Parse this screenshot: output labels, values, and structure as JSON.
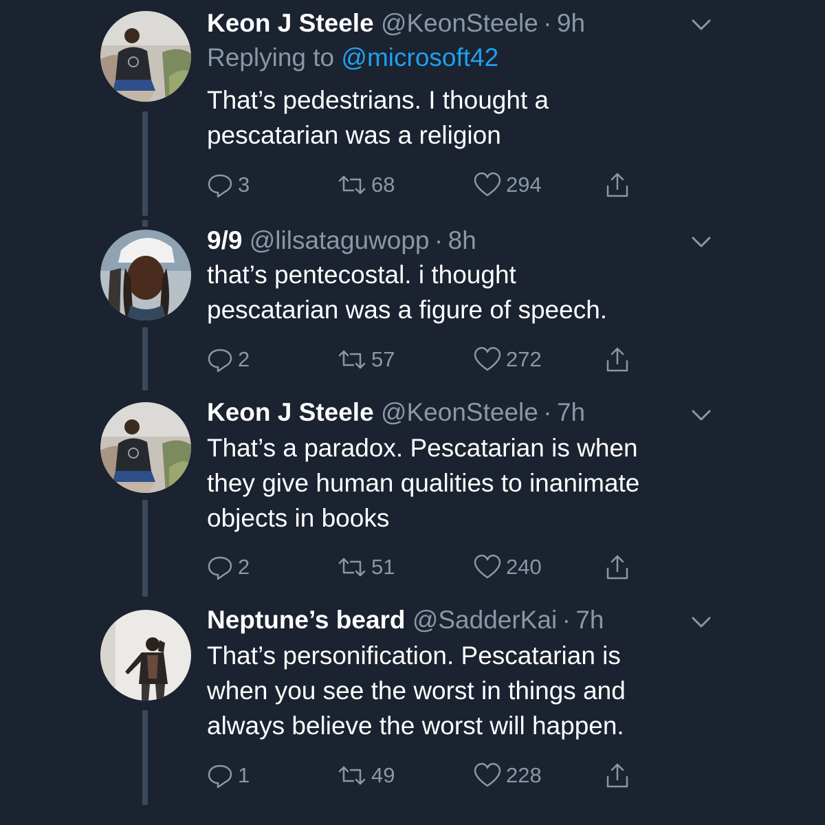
{
  "colors": {
    "background": "#1b2230",
    "secondary_text": "#8899a6",
    "link": "#1da1f2",
    "thread_line": "#3b4a5a"
  },
  "tweets": [
    {
      "display_name": "Keon J Steele",
      "handle": "@KeonSteele",
      "separator": "·",
      "time": "9h",
      "replying_prefix": "Replying to",
      "replying_to": "@microsoft42",
      "text_lines": [
        "That’s pedestrians. I thought a",
        "pescatarian was a religion"
      ],
      "replies": "3",
      "retweets": "68",
      "likes": "294",
      "avatar": "keon-avatar"
    },
    {
      "display_name": "9/9",
      "handle": "@lilsataguwopp",
      "separator": "·",
      "time": "8h",
      "text_lines": [
        "that’s pentecostal. i thought",
        "pescatarian was a figure of speech."
      ],
      "replies": "2",
      "retweets": "57",
      "likes": "272",
      "avatar": "lilsataguwopp-avatar"
    },
    {
      "display_name": "Keon J Steele",
      "handle": "@KeonSteele",
      "separator": "·",
      "time": "7h",
      "text_lines": [
        "That’s a paradox. Pescatarian is when",
        "they give human qualities to inanimate",
        "objects in books"
      ],
      "replies": "2",
      "retweets": "51",
      "likes": "240",
      "avatar": "keon-avatar"
    },
    {
      "display_name": "Neptune’s beard",
      "handle": "@SadderKai",
      "separator": "·",
      "time": "7h",
      "text_lines": [
        "That’s personification. Pescatarian is",
        "when you see the worst in things and",
        "always believe the worst will happen."
      ],
      "replies": "1",
      "retweets": "49",
      "likes": "228",
      "avatar": "sadderkai-avatar"
    }
  ],
  "icons": {
    "reply": "reply-icon",
    "retweet": "retweet-icon",
    "like": "heart-icon",
    "share": "share-icon",
    "menu": "chevron-down-icon"
  }
}
